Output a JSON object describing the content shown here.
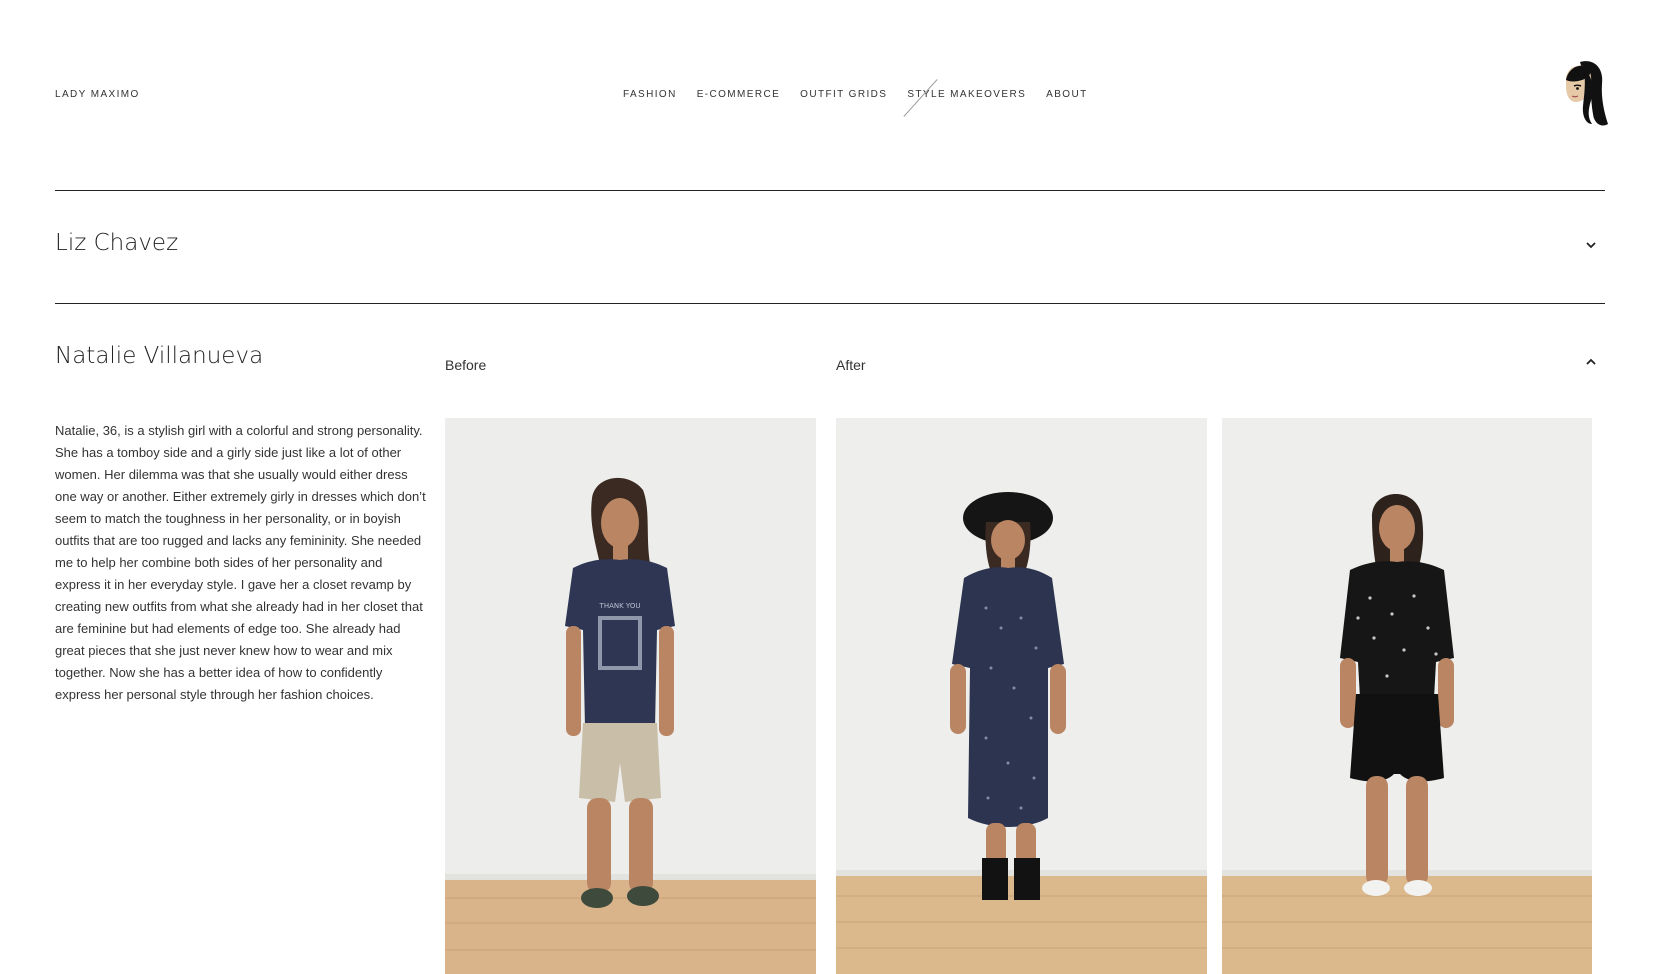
{
  "site": {
    "brand": "LADY MAXIMO"
  },
  "nav": {
    "items": [
      "FASHION",
      "E-COMMERCE",
      "OUTFIT GRIDS",
      "STYLE MAKEOVERS",
      "ABOUT"
    ]
  },
  "accordion": {
    "collapsed_title": "Liz Chavez",
    "expanded_title": "Natalie Villanueva",
    "before_label": "Before",
    "after_label": "After",
    "description": "Natalie, 36, is a stylish girl with a colorful and strong personality. She has a tomboy side and a girly side just like a lot of other women. Her dilemma was that she usually would either dress one way or another. Either extremely girly in dresses which don’t seem to match the toughness in her personality, or in boyish outfits that are too rugged and lacks any femininity. She needed me to help her combine both sides of her personality and express it in her everyday style. I gave her a closet revamp by creating new outfits from what she already had in her closet that are feminine but had elements of edge too. She already had great pieces that she just never knew how to wear and mix together. Now she has a better idea of how to confidently express her personal style through her fashion choices."
  },
  "colors": {
    "text": "#222222",
    "rule": "#222222",
    "wall": "#ececec",
    "floor": "#d9b48a",
    "navy": "#2c3450",
    "black": "#1a1a1a"
  },
  "icons": {
    "collapsed": "chevron-down-icon",
    "expanded": "chevron-up-icon"
  }
}
